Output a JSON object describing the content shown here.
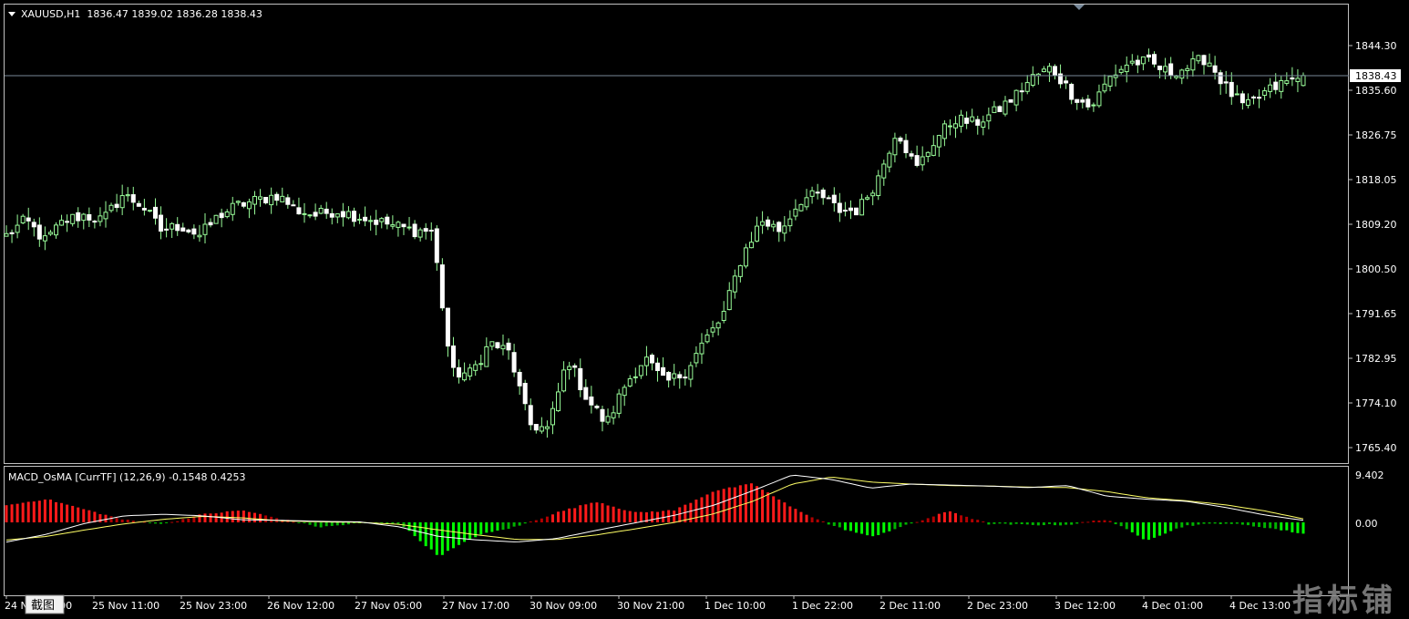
{
  "main": {
    "header": "XAUUSD,H1  1836.47 1839.02 1836.28 1838.43",
    "price_labels": [
      "1844.30",
      "1835.60",
      "1826.75",
      "1818.05",
      "1809.20",
      "1800.50",
      "1791.65",
      "1782.95",
      "1774.10",
      "1765.40"
    ],
    "current_price": "1838.43",
    "colors": {
      "background": "#000000",
      "frame": "#c0c0c0",
      "bull": "#000000",
      "bear": "#ffffff",
      "wick": "#98fb98",
      "bull_border": "#98fb98",
      "bear_border": "#ffffff",
      "price_line": "#778899"
    }
  },
  "sub": {
    "header": "MACD_OsMA [CurrTF] (12,26,9) -0.1548 0.4253",
    "scale_top": "9.402",
    "scale_zero": "0.00",
    "colors": {
      "hist_up": "#ff0000",
      "hist_down": "#00ff00",
      "macd": "#ffffff",
      "signal": "#ffff66"
    }
  },
  "time_labels": [
    "24 Nov 23:00",
    "25 Nov 11:00",
    "25 Nov 23:00",
    "26 Nov 12:00",
    "27 Nov 05:00",
    "27 Nov 17:00",
    "30 Nov 09:00",
    "30 Nov 21:00",
    "1 Dec 10:00",
    "1 Dec 22:00",
    "2 Dec 11:00",
    "2 Dec 23:00",
    "3 Dec 12:00",
    "4 Dec 01:00",
    "4 Dec 13:00"
  ],
  "screenshot_tooltip": "截图",
  "watermark": "指标铺",
  "chart_data": {
    "type": "candlestick",
    "symbol": "XAUUSD",
    "timeframe": "H1",
    "ohlc_last": {
      "open": 1836.47,
      "high": 1839.02,
      "low": 1836.28,
      "close": 1838.43
    },
    "ylim": [
      1763.0,
      1849.0
    ],
    "anchors": [
      1807,
      1810,
      1806,
      1810,
      1811,
      1810,
      1815,
      1813,
      1808,
      1809,
      1807,
      1811,
      1813,
      1814,
      1815,
      1812,
      1811,
      1812,
      1811,
      1810,
      1809,
      1808,
      1808,
      1780,
      1780,
      1786,
      1784,
      1770,
      1769,
      1783,
      1775,
      1770,
      1778,
      1783,
      1778,
      1780,
      1786,
      1791,
      1803,
      1810,
      1808,
      1814,
      1815,
      1812,
      1812,
      1818,
      1828,
      1820,
      1826,
      1830,
      1829,
      1831,
      1834,
      1838,
      1840,
      1835,
      1832,
      1838,
      1841,
      1841,
      1839,
      1840,
      1842,
      1836,
      1832,
      1835,
      1837,
      1838
    ],
    "macd_anchors": [
      -3.9,
      -2.4,
      -0.2,
      1.3,
      1.6,
      1.3,
      0.5,
      0.4,
      0.2,
      0.1,
      -0.9,
      -2.8,
      -3.5,
      -3.9,
      -3.2,
      -1.6,
      -0.1,
      1.4,
      3.4,
      6.3,
      9.4,
      8.5,
      6.8,
      7.6,
      7.4,
      7.2,
      6.9,
      7.3,
      5.2,
      4.6,
      4.2,
      3.0,
      1.5,
      0.4
    ],
    "signal_anchors": [
      -3.5,
      -2.8,
      -1.5,
      -0.3,
      0.6,
      1.2,
      0.9,
      0.3,
      0.1,
      0.0,
      -0.4,
      -1.5,
      -2.5,
      -3.4,
      -3.4,
      -2.5,
      -1.3,
      0.0,
      1.7,
      4.2,
      7.6,
      9.0,
      8.0,
      7.6,
      7.3,
      7.2,
      7.0,
      6.9,
      6.1,
      4.9,
      4.3,
      3.5,
      2.3,
      0.7
    ],
    "osma_anchors": [
      2.1,
      2.9,
      1.6,
      0.3,
      -0.2,
      1.0,
      1.5,
      0.4,
      -0.6,
      -0.1,
      -0.1,
      -4.2,
      -1.6,
      -0.5,
      1.2,
      2.6,
      1.2,
      1.5,
      3.9,
      4.8,
      1.8,
      -0.4,
      -1.8,
      -0.2,
      1.4,
      -0.2,
      -0.3,
      -0.3,
      0.4,
      -2.2,
      -0.4,
      -0.1,
      -0.6,
      -1.4
    ]
  }
}
